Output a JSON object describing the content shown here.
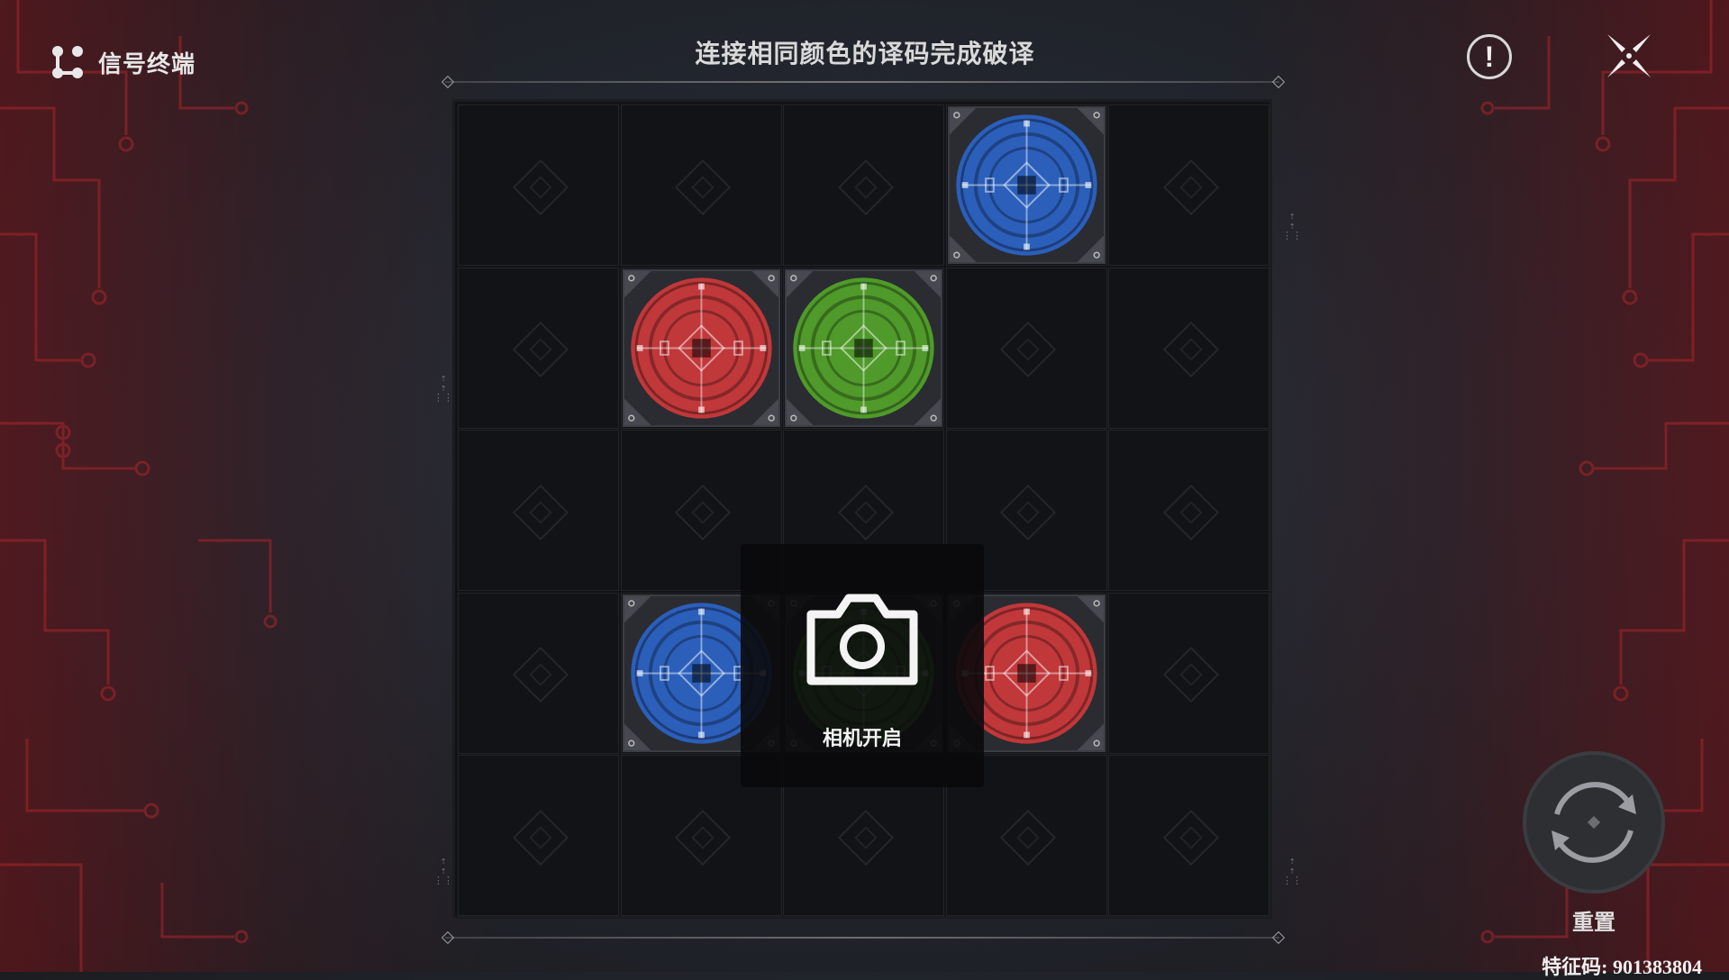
{
  "header": {
    "logo_label": "信号终端",
    "title": "连接相同颜色的译码完成破译"
  },
  "board": {
    "rows": 5,
    "cols": 5,
    "nodes": [
      {
        "row": 0,
        "col": 3,
        "color": "blue"
      },
      {
        "row": 1,
        "col": 1,
        "color": "red"
      },
      {
        "row": 1,
        "col": 2,
        "color": "green"
      },
      {
        "row": 3,
        "col": 1,
        "color": "blue"
      },
      {
        "row": 3,
        "col": 2,
        "color": "green"
      },
      {
        "row": 3,
        "col": 3,
        "color": "red"
      }
    ]
  },
  "colors": {
    "red": "#c0383a",
    "green": "#4f9a2a",
    "blue": "#2b5fba"
  },
  "camera": {
    "label": "相机开启",
    "icon": "camera-icon"
  },
  "controls": {
    "info_icon": "exclamation-icon",
    "info_glyph": "!",
    "close_icon": "close-icon",
    "reset_icon": "refresh-icon",
    "reset_label": "重置"
  },
  "footer": {
    "feature_code": "特征码: 901383804"
  }
}
